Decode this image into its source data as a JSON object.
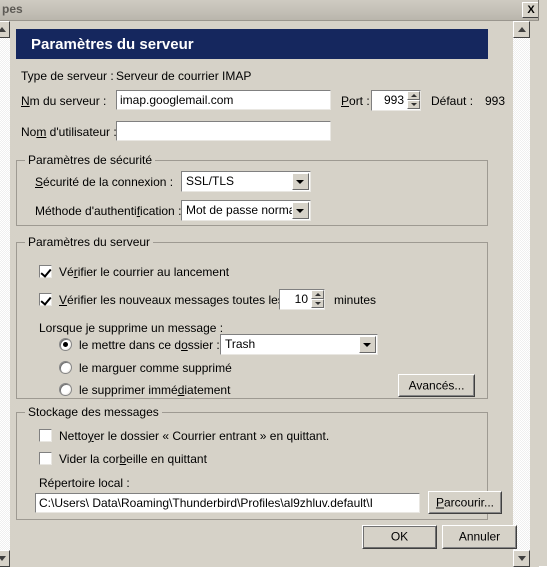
{
  "window": {
    "title_fragment": "pes",
    "close_label": "X"
  },
  "pane": {
    "header": "Paramètres du serveur"
  },
  "server": {
    "type_label": "Type de serveur :",
    "type_value": "Serveur de courrier IMAP",
    "hostname_label_pre": "N",
    "hostname_label_accesskey": "o",
    "hostname_label_post": "m du serveur :",
    "hostname_label": "Nom du serveur :",
    "hostname_value": "imap.googlemail.com",
    "port_label": "Port :",
    "port_value": "993",
    "default_port_label": "Défaut :",
    "default_port_value": "993",
    "username_label": "Nom d'utilisateur :",
    "username_value": ""
  },
  "security": {
    "caption": "Paramètres de sécurité",
    "connection_label": "Sécurité de la connexion :",
    "connection_value": "SSL/TLS",
    "connection_options": [
      "SSL/TLS"
    ],
    "auth_label": "Méthode d'authentification :",
    "auth_value": "Mot de passe normal",
    "auth_options": [
      "Mot de passe normal"
    ]
  },
  "server_settings": {
    "caption": "Paramètres du serveur",
    "check_at_startup_label": "Vérifier le courrier au lancement",
    "check_at_startup_checked": true,
    "check_interval_label": "Vérifier les nouveaux messages toutes les",
    "check_interval_value": "10",
    "check_interval_suffix": "minutes",
    "check_interval_checked": true,
    "on_delete_label": "Lorsque je supprime un message :",
    "radio_move_label": "le mettre dans ce dossier :",
    "radio_move_selected": true,
    "folder_value": "Trash",
    "folder_options": [
      "Trash"
    ],
    "radio_mark_label": "le marquer comme supprimé",
    "radio_mark_selected": false,
    "radio_remove_label": "le supprimer immédiatement",
    "radio_remove_selected": false,
    "advanced_button": "Avancés..."
  },
  "storage": {
    "caption": "Stockage des messages",
    "clean_inbox_label": "Nettoyer le dossier « Courrier entrant » en quittant.",
    "clean_inbox_checked": false,
    "empty_trash_label": "Vider la corbeille en quittant",
    "empty_trash_checked": false,
    "local_dir_label": "Répertoire local :",
    "local_dir_value": "C:\\Users\\                    Data\\Roaming\\Thunderbird\\Profiles\\al9zhluv.default\\I",
    "browse_button": "Parcourir..."
  },
  "footer": {
    "ok_button": "OK",
    "cancel_button": "Annuler"
  },
  "colors": {
    "header_blue": "#15275e",
    "dialog_face": "#d6d2c8",
    "field_white": "#ffffff"
  }
}
